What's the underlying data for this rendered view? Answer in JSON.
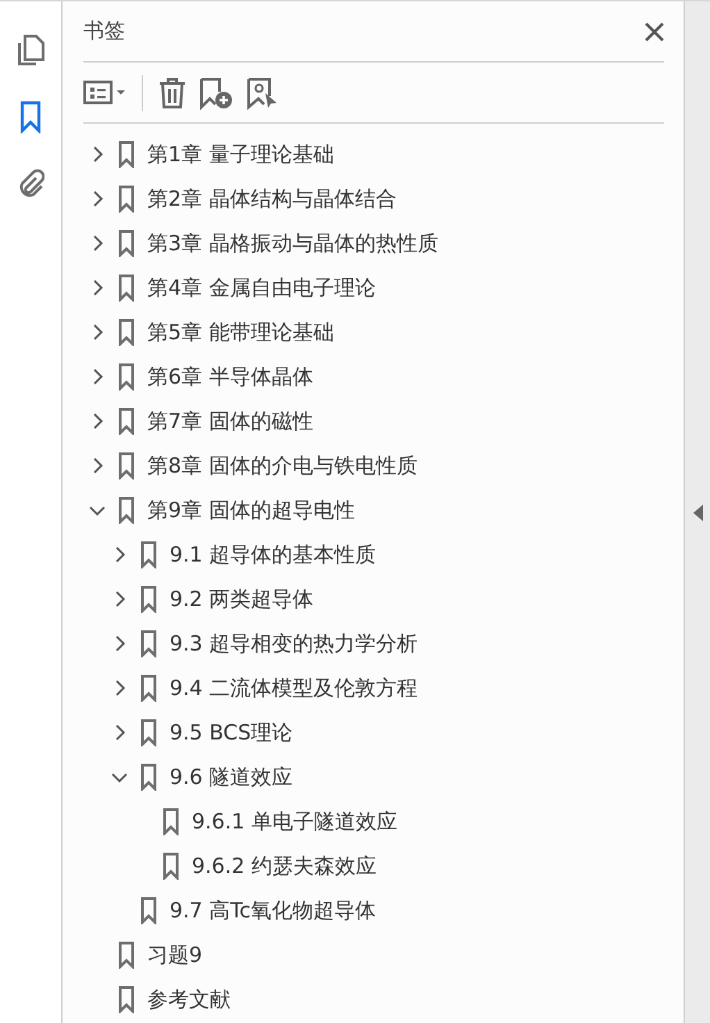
{
  "panel": {
    "title": "书签"
  },
  "rail": [
    {
      "kind": "pages",
      "selected": false
    },
    {
      "kind": "bookmarks",
      "selected": true
    },
    {
      "kind": "attachments",
      "selected": false
    }
  ],
  "bookmarks": [
    {
      "label": "第1章 量子理论基础",
      "expanded": false
    },
    {
      "label": "第2章 晶体结构与晶体结合",
      "expanded": false
    },
    {
      "label": "第3章 晶格振动与晶体的热性质",
      "expanded": false
    },
    {
      "label": "第4章 金属自由电子理论",
      "expanded": false
    },
    {
      "label": "第5章 能带理论基础",
      "expanded": false
    },
    {
      "label": "第6章 半导体晶体",
      "expanded": false
    },
    {
      "label": "第7章 固体的磁性",
      "expanded": false
    },
    {
      "label": "第8章 固体的介电与铁电性质",
      "expanded": false
    },
    {
      "label": "第9章 固体的超导电性",
      "expanded": true,
      "children": [
        {
          "label": "9.1 超导体的基本性质",
          "expanded": false
        },
        {
          "label": "9.2 两类超导体",
          "expanded": false
        },
        {
          "label": "9.3 超导相变的热力学分析",
          "expanded": false
        },
        {
          "label": "9.4 二流体模型及伦敦方程",
          "expanded": false
        },
        {
          "label": "9.5 BCS理论",
          "expanded": false
        },
        {
          "label": "9.6 隧道效应",
          "expanded": true,
          "children": [
            {
              "label": "9.6.1 单电子隧道效应"
            },
            {
              "label": "9.6.2 约瑟夫森效应"
            }
          ]
        },
        {
          "label": "9.7 高Tc氧化物超导体"
        }
      ]
    },
    {
      "label": "习题9"
    },
    {
      "label": "参考文献"
    }
  ]
}
